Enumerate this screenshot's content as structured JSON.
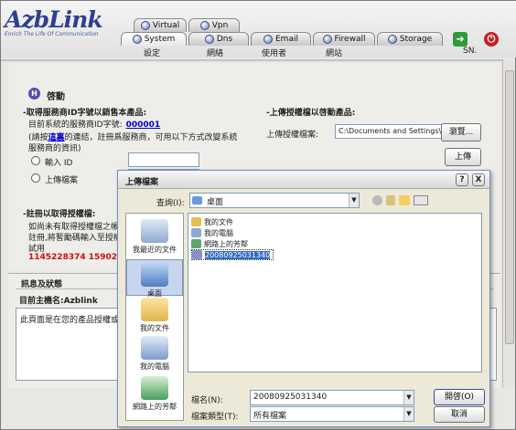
{
  "brand": {
    "logo": "AzbLink",
    "tagline": "Enrich The Life Of Communication"
  },
  "tabs_top": [
    {
      "label": "Virtual"
    },
    {
      "label": "Vpn"
    }
  ],
  "tabs_main": [
    {
      "label": "System"
    },
    {
      "label": "Dns"
    },
    {
      "label": "Email"
    },
    {
      "label": "Firewall"
    },
    {
      "label": "Storage"
    }
  ],
  "sub_menu": [
    "設定",
    "網絡",
    "使用者",
    "網站",
    "SN."
  ],
  "page": {
    "section_title": "啓動",
    "left_heading": "-取得服務商ID字號以銷售本產品:",
    "id_line": "目前系統的服務商ID字號:",
    "id_value": "000001",
    "hint_line1_pre": "(請按",
    "hint_link": "這裏",
    "hint_line1_post": "的連結，註冊爲服務商，可用以下方式改變系統",
    "hint_line2": "服務商的資訊)",
    "radio_input_label": "輸入 ID",
    "radio_upload_label": "上傳檔案",
    "lower_heading": "-註冊以取得授權檔:",
    "lower_line1": "如尚未有取得授權檔之帳號",
    "lower_line2": "註冊,將暫勵碼輸入至授權",
    "lower_line3": "試用",
    "phone": "1145228374 1590279782",
    "right_heading": "-上傳授權檔以啓動產品:",
    "upload_label": "上傳授權檔案:",
    "upload_path": "C:\\Documents and Settings\\Ch",
    "browse_button": "瀏覽...",
    "upload_button": "上傳"
  },
  "messages": {
    "title": "訊息及狀態",
    "host_label": "目前主機名:Azblink",
    "message_text": "此頁面是在您的產品授權或"
  },
  "dialog": {
    "title": "上傳檔案",
    "help_button": "?",
    "close_button": "X",
    "lookin_label": "查詢(I):",
    "lookin_value": "桌面",
    "places": [
      "我最近的文件",
      "桌面",
      "我的文件",
      "我的電腦",
      "網路上的芳鄰"
    ],
    "files": [
      "我的文件",
      "我的電腦",
      "網路上的芳鄰",
      "20080925031340"
    ],
    "filename_label": "檔名(N):",
    "filename_value": "20080925031340",
    "filetype_label": "檔案類型(T):",
    "filetype_value": "所有檔案",
    "open_button": "開啓(O)",
    "cancel_button": "取消"
  },
  "colors": {
    "brand": "#2f3f8f",
    "link": "#0000cc",
    "phone": "#d01010",
    "selection": "#316ac5"
  }
}
